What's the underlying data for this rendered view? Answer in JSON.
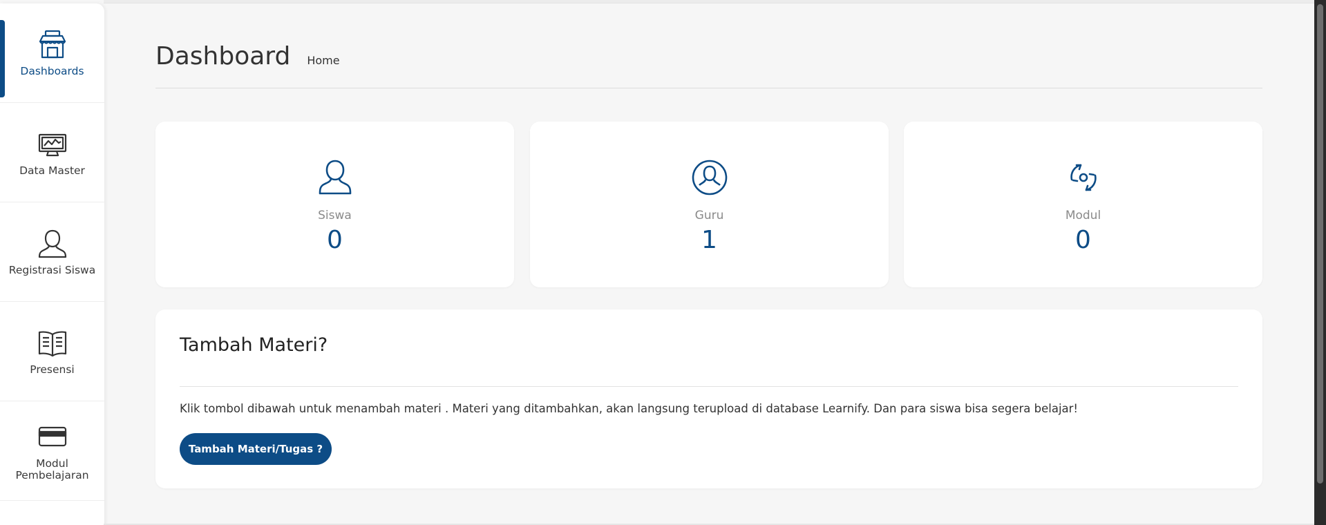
{
  "sidebar": {
    "items": [
      {
        "label": "Dashboards",
        "icon": "dashboard-shop-icon",
        "active": true
      },
      {
        "label": "Data Master",
        "icon": "monitor-icon",
        "active": false
      },
      {
        "label": "Registrasi Siswa",
        "icon": "user-icon",
        "active": false
      },
      {
        "label": "Presensi",
        "icon": "book-icon",
        "active": false
      },
      {
        "label": "Modul Pembelajaran",
        "icon": "card-icon",
        "active": false
      }
    ]
  },
  "header": {
    "title": "Dashboard",
    "breadcrumb": "Home"
  },
  "stats": [
    {
      "label": "Siswa",
      "value": "0",
      "icon": "student-icon"
    },
    {
      "label": "Guru",
      "value": "1",
      "icon": "teacher-icon"
    },
    {
      "label": "Modul",
      "value": "0",
      "icon": "module-sync-icon"
    }
  ],
  "info_card": {
    "title": "Tambah Materi?",
    "text": "Klik tombol dibawah untuk menambah materi . Materi yang ditambahkan, akan langsung terupload di database Learnify. Dan para siswa bisa segera belajar!",
    "button_label": "Tambah Materi/Tugas ?"
  },
  "colors": {
    "primary": "#0d4c86",
    "background": "#f6f6f6",
    "card": "#ffffff"
  }
}
